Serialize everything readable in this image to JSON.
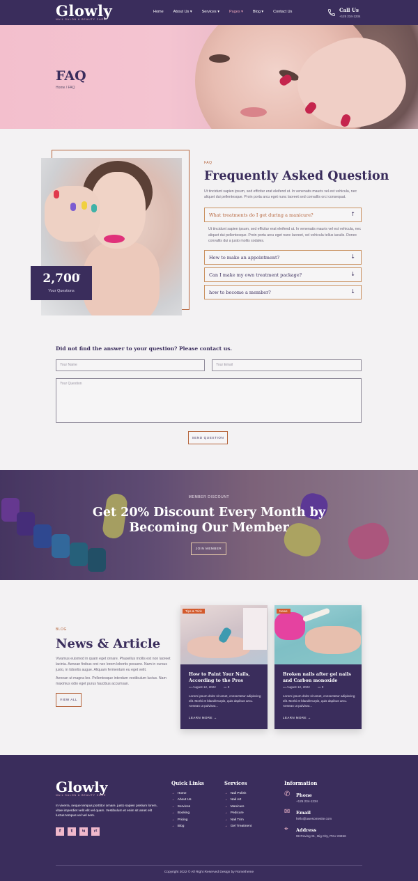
{
  "header": {
    "logo": "Glowly",
    "logo_sub": "NAIL SALON & BEAUTY CARE",
    "nav": [
      "Home",
      "About Us ▾",
      "Services ▾",
      "Pages ▾",
      "Blog ▾",
      "Contact Us"
    ],
    "call_label": "Call Us",
    "call_number": "+125 234-1234"
  },
  "hero": {
    "title": "FAQ",
    "breadcrumb": "Home / FAQ"
  },
  "faq": {
    "stat_value": "2,700",
    "stat_plus": "+",
    "stat_label": "Your Questions",
    "eyebrow": "FAQ",
    "title": "Frequently Asked Question",
    "intro": "Ut tincidunt sapien ipsum, sed efficitur erat eleifend ut. In venenatis mauris vel est vehicula, nec aliquet dui pellentesque. Proin porta arcu eget nunc laoreet sed convallis orci consequat.",
    "items": [
      {
        "question": "What treatments do I get during a manicure?",
        "arrow": "↑"
      },
      {
        "question": "How to make an appointment?",
        "arrow": "↓"
      },
      {
        "question": "Can I make my own treatment package?",
        "arrow": "↓"
      },
      {
        "question": "how to become a member?",
        "arrow": "↓"
      }
    ],
    "answer": "Ut tincidunt sapien ipsum, sed efficitur erat eleifend ut. In venenatis mauris vel est vehicula, nec aliquet dui pellentesque. Proin porta arcu eget nunc laoreet, vel vehicula tellus iaculis. Donec convallis dui a justo mollis sodales."
  },
  "contact": {
    "title": "Did not find the answer to your question? Please contact us.",
    "name_placeholder": "Your Name",
    "email_placeholder": "Your Email",
    "question_placeholder": "Your Question",
    "send_label": "SEND QUESTION"
  },
  "promo": {
    "eyebrow": "MEMBER DISCOUNT",
    "title_line1": "Get 20% Discount Every Month by",
    "title_line2": "Becoming Our Member",
    "button": "JOIN MEMBER"
  },
  "news": {
    "eyebrow": "BLOG",
    "title": "News & Article",
    "p1": "Vivamus euismod in quam eget ornare. Phasellus mollis est non laoreet lacinia. Aenean finibus orci nec lorem lobortis posuere. Nam in cursus justo, in lobortis augue. Aliquam fermentum eu eget velit.",
    "p2": "Aenean ut magna leo. Pellentesque interdum vestibulum luctus. Nam maximus odio eget purus faucibus accumsan.",
    "view_all": "VIEW ALL",
    "cards": [
      {
        "tag": "Tips & Trick",
        "title": "How to Paint Your Nails, According to the Pros",
        "date": "August 12, 2022",
        "comments": "0",
        "excerpt": "Lorem ipsum dolor sit amet, consectetur adipiscing elit. Morbi et blandit turpis, quis dapibus arcu. Aenean ut pulvinar...",
        "more": "LEARN MORE →"
      },
      {
        "tag": "News",
        "title": "Broken nails after gel nails and Carbon monoxide",
        "date": "August 12, 2022",
        "comments": "0",
        "excerpt": "Lorem ipsum dolor sit amet, consectetur adipiscing elit. Morbi et blandit turpis, quis dapibus arcu. Aenean ut pulvinar...",
        "more": "LEARN MORE →"
      }
    ]
  },
  "footer": {
    "logo": "Glowly",
    "logo_sub": "NAIL SALON & BEAUTY CARE",
    "about": "In viverra, neque tempus porttitor ornare, justo sapien pretium lorem, vitae imperdiet velit elit vel quam. Vestibulum et enim sit amet elit luctus tempus vel vel sem.",
    "social": [
      "f",
      "t",
      "ig",
      "yt"
    ],
    "quick_links_title": "Quick Links",
    "quick_links": [
      "Home",
      "About Us",
      "Services",
      "Booking",
      "Pricing",
      "Blog"
    ],
    "services_title": "Services",
    "services": [
      "Nail Polish",
      "Nail Art",
      "Manicure",
      "Pedicure",
      "Nail Trim",
      "Gel Treatment"
    ],
    "info_title": "Information",
    "phone_label": "Phone",
    "phone": "+125 234-1234",
    "email_label": "Email",
    "email": "hello@awesomesite.com",
    "address_label": "Address",
    "address": "99 Roving St., Big City, PKU 23456",
    "copyright": "Copyright 2022 © All Right Reserved Design by Rometheme"
  },
  "colors": {
    "brand": "#3a2d5c",
    "accent": "#b5643b",
    "pink": "#f0b8cb"
  }
}
